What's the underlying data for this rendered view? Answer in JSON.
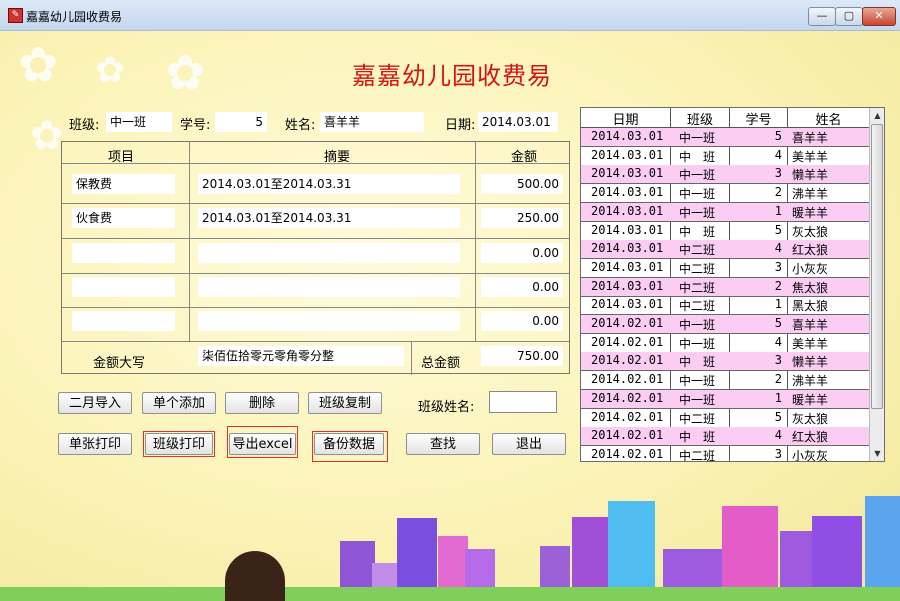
{
  "window": {
    "title": "嘉嘉幼儿园收费易"
  },
  "heading": "嘉嘉幼儿园收费易",
  "info": {
    "class_label": "班级:",
    "class_value": "中一班",
    "student_no_label": "学号:",
    "student_no_value": "5",
    "name_label": "姓名:",
    "name_value": "喜羊羊",
    "date_label": "日期:",
    "date_value": "2014.03.01"
  },
  "grid": {
    "headers": {
      "item": "项目",
      "summary": "摘要",
      "amount": "金额"
    },
    "rows": [
      {
        "item": "保教费",
        "summary": "2014.03.01至2014.03.31",
        "amount": "500.00"
      },
      {
        "item": "伙食费",
        "summary": "2014.03.01至2014.03.31",
        "amount": "250.00"
      },
      {
        "item": "",
        "summary": "",
        "amount": "0.00"
      },
      {
        "item": "",
        "summary": "",
        "amount": "0.00"
      },
      {
        "item": "",
        "summary": "",
        "amount": "0.00"
      }
    ],
    "uppercase_label": "金额大写",
    "uppercase_value": "柒佰伍拾零元零角零分整",
    "total_label": "总金额",
    "total_value": "750.00"
  },
  "buttons": {
    "import_month": "二月导入",
    "add_single": "单个添加",
    "delete": "删除",
    "copy_class": "班级复制",
    "class_name_label": "班级姓名:",
    "print_single": "单张打印",
    "print_class": "班级打印",
    "export_excel": "导出excel",
    "backup": "备份数据",
    "search": "查找",
    "exit": "退出"
  },
  "list": {
    "headers": [
      "日期",
      "班级",
      "学号",
      "姓名"
    ],
    "rows": [
      [
        "2014.03.01",
        "中一班",
        "5",
        "喜羊羊"
      ],
      [
        "2014.03.01",
        "中　班",
        "4",
        "美羊羊"
      ],
      [
        "2014.03.01",
        "中一班",
        "3",
        "懒羊羊"
      ],
      [
        "2014.03.01",
        "中一班",
        "2",
        "沸羊羊"
      ],
      [
        "2014.03.01",
        "中一班",
        "1",
        "暖羊羊"
      ],
      [
        "2014.03.01",
        "中　班",
        "5",
        "灰太狼"
      ],
      [
        "2014.03.01",
        "中二班",
        "4",
        "红太狼"
      ],
      [
        "2014.03.01",
        "中二班",
        "3",
        "小灰灰"
      ],
      [
        "2014.03.01",
        "中二班",
        "2",
        "焦太狼"
      ],
      [
        "2014.03.01",
        "中二班",
        "1",
        "黑太狼"
      ],
      [
        "2014.02.01",
        "中一班",
        "5",
        "喜羊羊"
      ],
      [
        "2014.02.01",
        "中一班",
        "4",
        "美羊羊"
      ],
      [
        "2014.02.01",
        "中　班",
        "3",
        "懒羊羊"
      ],
      [
        "2014.02.01",
        "中一班",
        "2",
        "沸羊羊"
      ],
      [
        "2014.02.01",
        "中一班",
        "1",
        "暖羊羊"
      ],
      [
        "2014.02.01",
        "中二班",
        "5",
        "灰太狼"
      ],
      [
        "2014.02.01",
        "中　班",
        "4",
        "红太狼"
      ],
      [
        "2014.02.01",
        "中二班",
        "3",
        "小灰灰"
      ]
    ]
  },
  "colors": {
    "heading": "#d21414",
    "row_pink": "#fbcdf2",
    "highlight": "#e53030",
    "background": "#f7f0a8"
  }
}
